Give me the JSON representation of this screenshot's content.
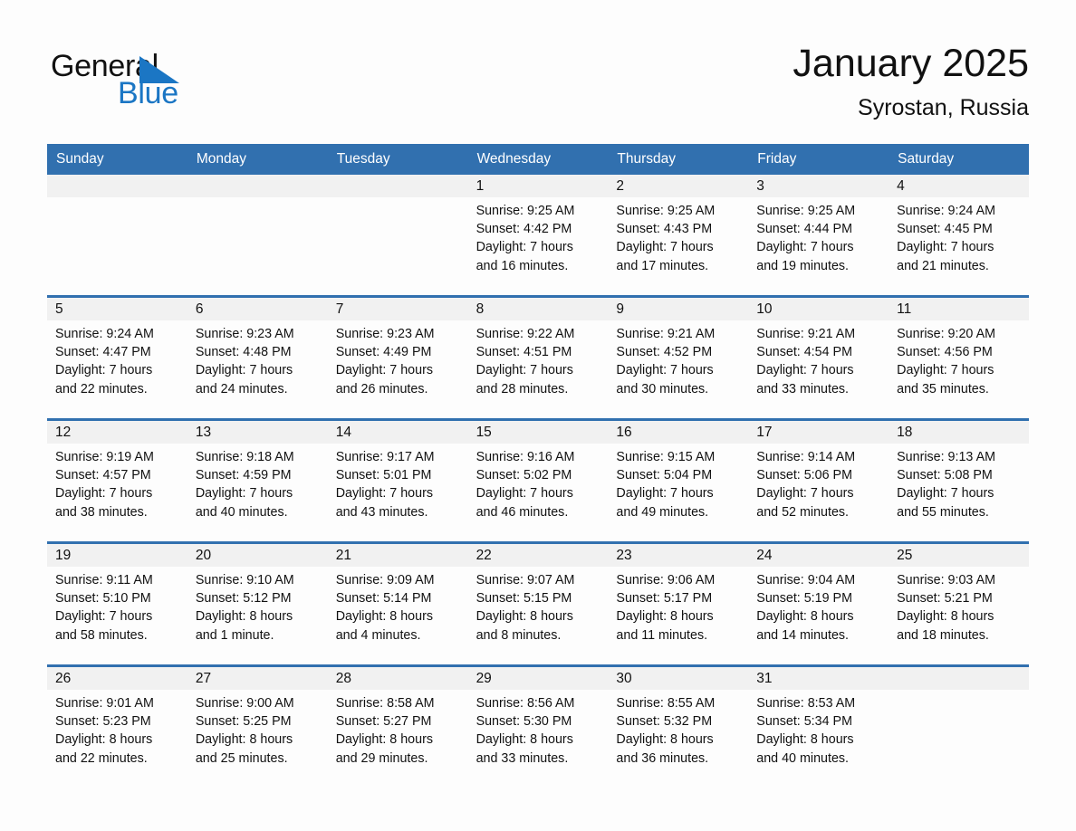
{
  "brand": {
    "name_line1": "General",
    "name_line2": "Blue",
    "mark": "triangle-icon",
    "accent_color": "#1b76c4"
  },
  "header": {
    "month_title": "January 2025",
    "location": "Syrostan, Russia"
  },
  "theme": {
    "header_blue": "#3170AF",
    "row_divider_blue": "#3170AF",
    "day_strip_gray": "#F1F1F1",
    "page_background": "#FDFDFD",
    "text_color": "#111111"
  },
  "weekdays": [
    "Sunday",
    "Monday",
    "Tuesday",
    "Wednesday",
    "Thursday",
    "Friday",
    "Saturday"
  ],
  "weeks": [
    [
      {
        "day": "",
        "empty": true
      },
      {
        "day": "",
        "empty": true
      },
      {
        "day": "",
        "empty": true
      },
      {
        "day": "1",
        "sunrise": "Sunrise: 9:25 AM",
        "sunset": "Sunset: 4:42 PM",
        "daylight_line1": "Daylight: 7 hours",
        "daylight_line2": "and 16 minutes."
      },
      {
        "day": "2",
        "sunrise": "Sunrise: 9:25 AM",
        "sunset": "Sunset: 4:43 PM",
        "daylight_line1": "Daylight: 7 hours",
        "daylight_line2": "and 17 minutes."
      },
      {
        "day": "3",
        "sunrise": "Sunrise: 9:25 AM",
        "sunset": "Sunset: 4:44 PM",
        "daylight_line1": "Daylight: 7 hours",
        "daylight_line2": "and 19 minutes."
      },
      {
        "day": "4",
        "sunrise": "Sunrise: 9:24 AM",
        "sunset": "Sunset: 4:45 PM",
        "daylight_line1": "Daylight: 7 hours",
        "daylight_line2": "and 21 minutes."
      }
    ],
    [
      {
        "day": "5",
        "sunrise": "Sunrise: 9:24 AM",
        "sunset": "Sunset: 4:47 PM",
        "daylight_line1": "Daylight: 7 hours",
        "daylight_line2": "and 22 minutes."
      },
      {
        "day": "6",
        "sunrise": "Sunrise: 9:23 AM",
        "sunset": "Sunset: 4:48 PM",
        "daylight_line1": "Daylight: 7 hours",
        "daylight_line2": "and 24 minutes."
      },
      {
        "day": "7",
        "sunrise": "Sunrise: 9:23 AM",
        "sunset": "Sunset: 4:49 PM",
        "daylight_line1": "Daylight: 7 hours",
        "daylight_line2": "and 26 minutes."
      },
      {
        "day": "8",
        "sunrise": "Sunrise: 9:22 AM",
        "sunset": "Sunset: 4:51 PM",
        "daylight_line1": "Daylight: 7 hours",
        "daylight_line2": "and 28 minutes."
      },
      {
        "day": "9",
        "sunrise": "Sunrise: 9:21 AM",
        "sunset": "Sunset: 4:52 PM",
        "daylight_line1": "Daylight: 7 hours",
        "daylight_line2": "and 30 minutes."
      },
      {
        "day": "10",
        "sunrise": "Sunrise: 9:21 AM",
        "sunset": "Sunset: 4:54 PM",
        "daylight_line1": "Daylight: 7 hours",
        "daylight_line2": "and 33 minutes."
      },
      {
        "day": "11",
        "sunrise": "Sunrise: 9:20 AM",
        "sunset": "Sunset: 4:56 PM",
        "daylight_line1": "Daylight: 7 hours",
        "daylight_line2": "and 35 minutes."
      }
    ],
    [
      {
        "day": "12",
        "sunrise": "Sunrise: 9:19 AM",
        "sunset": "Sunset: 4:57 PM",
        "daylight_line1": "Daylight: 7 hours",
        "daylight_line2": "and 38 minutes."
      },
      {
        "day": "13",
        "sunrise": "Sunrise: 9:18 AM",
        "sunset": "Sunset: 4:59 PM",
        "daylight_line1": "Daylight: 7 hours",
        "daylight_line2": "and 40 minutes."
      },
      {
        "day": "14",
        "sunrise": "Sunrise: 9:17 AM",
        "sunset": "Sunset: 5:01 PM",
        "daylight_line1": "Daylight: 7 hours",
        "daylight_line2": "and 43 minutes."
      },
      {
        "day": "15",
        "sunrise": "Sunrise: 9:16 AM",
        "sunset": "Sunset: 5:02 PM",
        "daylight_line1": "Daylight: 7 hours",
        "daylight_line2": "and 46 minutes."
      },
      {
        "day": "16",
        "sunrise": "Sunrise: 9:15 AM",
        "sunset": "Sunset: 5:04 PM",
        "daylight_line1": "Daylight: 7 hours",
        "daylight_line2": "and 49 minutes."
      },
      {
        "day": "17",
        "sunrise": "Sunrise: 9:14 AM",
        "sunset": "Sunset: 5:06 PM",
        "daylight_line1": "Daylight: 7 hours",
        "daylight_line2": "and 52 minutes."
      },
      {
        "day": "18",
        "sunrise": "Sunrise: 9:13 AM",
        "sunset": "Sunset: 5:08 PM",
        "daylight_line1": "Daylight: 7 hours",
        "daylight_line2": "and 55 minutes."
      }
    ],
    [
      {
        "day": "19",
        "sunrise": "Sunrise: 9:11 AM",
        "sunset": "Sunset: 5:10 PM",
        "daylight_line1": "Daylight: 7 hours",
        "daylight_line2": "and 58 minutes."
      },
      {
        "day": "20",
        "sunrise": "Sunrise: 9:10 AM",
        "sunset": "Sunset: 5:12 PM",
        "daylight_line1": "Daylight: 8 hours",
        "daylight_line2": "and 1 minute."
      },
      {
        "day": "21",
        "sunrise": "Sunrise: 9:09 AM",
        "sunset": "Sunset: 5:14 PM",
        "daylight_line1": "Daylight: 8 hours",
        "daylight_line2": "and 4 minutes."
      },
      {
        "day": "22",
        "sunrise": "Sunrise: 9:07 AM",
        "sunset": "Sunset: 5:15 PM",
        "daylight_line1": "Daylight: 8 hours",
        "daylight_line2": "and 8 minutes."
      },
      {
        "day": "23",
        "sunrise": "Sunrise: 9:06 AM",
        "sunset": "Sunset: 5:17 PM",
        "daylight_line1": "Daylight: 8 hours",
        "daylight_line2": "and 11 minutes."
      },
      {
        "day": "24",
        "sunrise": "Sunrise: 9:04 AM",
        "sunset": "Sunset: 5:19 PM",
        "daylight_line1": "Daylight: 8 hours",
        "daylight_line2": "and 14 minutes."
      },
      {
        "day": "25",
        "sunrise": "Sunrise: 9:03 AM",
        "sunset": "Sunset: 5:21 PM",
        "daylight_line1": "Daylight: 8 hours",
        "daylight_line2": "and 18 minutes."
      }
    ],
    [
      {
        "day": "26",
        "sunrise": "Sunrise: 9:01 AM",
        "sunset": "Sunset: 5:23 PM",
        "daylight_line1": "Daylight: 8 hours",
        "daylight_line2": "and 22 minutes."
      },
      {
        "day": "27",
        "sunrise": "Sunrise: 9:00 AM",
        "sunset": "Sunset: 5:25 PM",
        "daylight_line1": "Daylight: 8 hours",
        "daylight_line2": "and 25 minutes."
      },
      {
        "day": "28",
        "sunrise": "Sunrise: 8:58 AM",
        "sunset": "Sunset: 5:27 PM",
        "daylight_line1": "Daylight: 8 hours",
        "daylight_line2": "and 29 minutes."
      },
      {
        "day": "29",
        "sunrise": "Sunrise: 8:56 AM",
        "sunset": "Sunset: 5:30 PM",
        "daylight_line1": "Daylight: 8 hours",
        "daylight_line2": "and 33 minutes."
      },
      {
        "day": "30",
        "sunrise": "Sunrise: 8:55 AM",
        "sunset": "Sunset: 5:32 PM",
        "daylight_line1": "Daylight: 8 hours",
        "daylight_line2": "and 36 minutes."
      },
      {
        "day": "31",
        "sunrise": "Sunrise: 8:53 AM",
        "sunset": "Sunset: 5:34 PM",
        "daylight_line1": "Daylight: 8 hours",
        "daylight_line2": "and 40 minutes."
      },
      {
        "day": "",
        "empty": true
      }
    ]
  ]
}
